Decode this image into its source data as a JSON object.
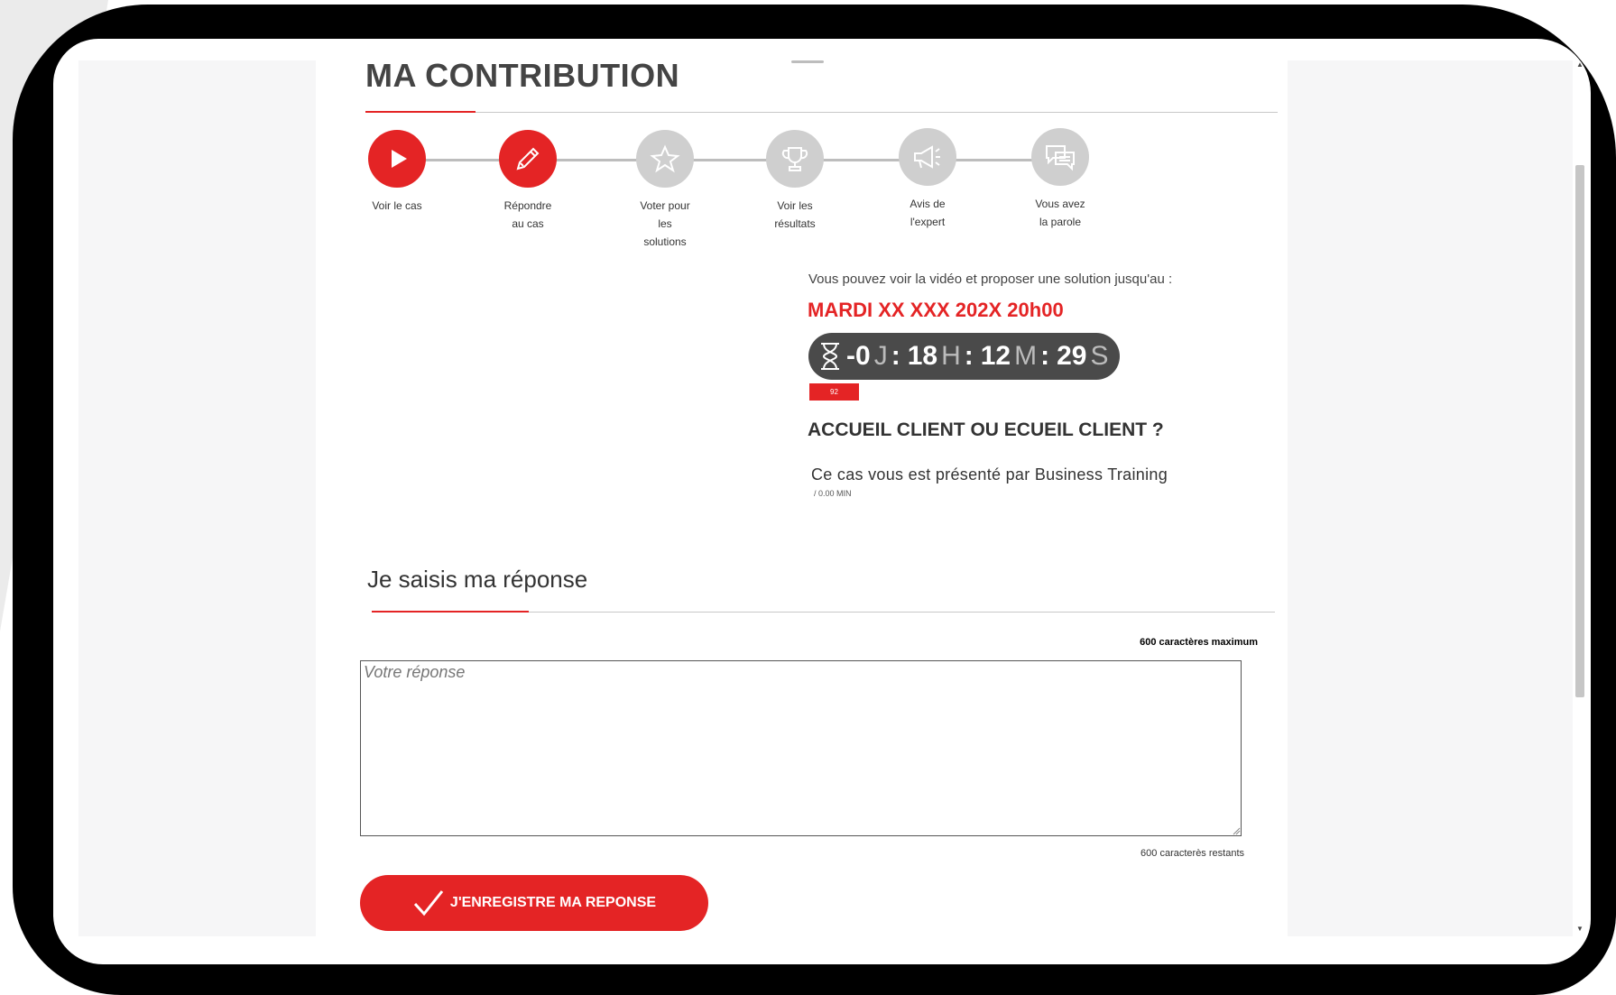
{
  "page": {
    "title": "MA CONTRIBUTION"
  },
  "steps": [
    {
      "label_lines": [
        "Voir le cas"
      ],
      "icon": "play-icon",
      "state": "active"
    },
    {
      "label_lines": [
        "Répondre",
        "au cas"
      ],
      "icon": "pencil-icon",
      "state": "active"
    },
    {
      "label_lines": [
        "Voter pour",
        "les",
        "solutions"
      ],
      "icon": "star-icon",
      "state": "inactive"
    },
    {
      "label_lines": [
        "Voir les",
        "résultats"
      ],
      "icon": "trophy-icon",
      "state": "inactive"
    },
    {
      "label_lines": [
        "Avis de",
        "l'expert"
      ],
      "icon": "megaphone-icon",
      "state": "inactive"
    },
    {
      "label_lines": [
        "Vous avez",
        "la parole"
      ],
      "icon": "chat-icon",
      "state": "inactive"
    }
  ],
  "info": {
    "text": "Vous pouvez voir la vidéo et proposer une solution jusqu'au :",
    "deadline": "MARDI XX XXX 202X 20h00"
  },
  "countdown": {
    "days": "-0",
    "days_unit": "J",
    "hours": "18",
    "hours_unit": "H",
    "minutes": "12",
    "minutes_unit": "M",
    "seconds": "29",
    "seconds_unit": "S",
    "separator": ":"
  },
  "badge": "92",
  "case": {
    "title": "ACCUEIL CLIENT OU ECUEIL CLIENT ?",
    "presenter": "Ce cas vous est présenté par Business Training",
    "duration": "/ 0.00 MIN"
  },
  "response": {
    "section_title": "Je saisis ma réponse",
    "max_chars": "600 caractères maximum",
    "placeholder": "Votre réponse",
    "value": "",
    "remaining": "600 caracterès restants",
    "save_label": "J'ENREGISTRE MA REPONSE"
  },
  "colors": {
    "accent": "#e42425",
    "inactive": "#cfcfcf",
    "countdown_bg": "#4a4a4a"
  }
}
